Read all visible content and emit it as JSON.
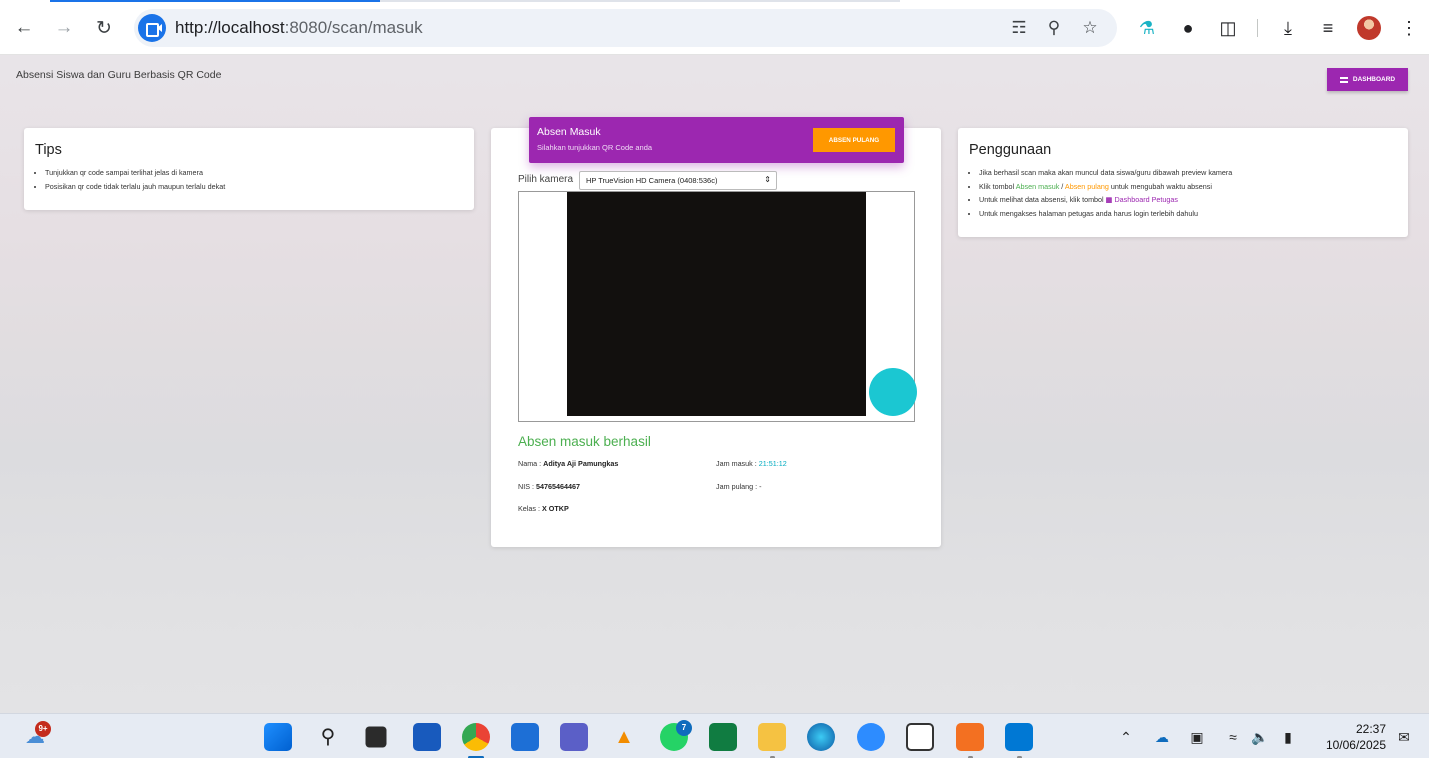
{
  "browser": {
    "url_host": "http://localhost",
    "url_path": ":8080/scan/masuk"
  },
  "page": {
    "app_title": "Absensi Siswa dan Guru Berbasis QR Code",
    "dashboard_button": "DASHBOARD"
  },
  "tips": {
    "title": "Tips",
    "items": [
      "Tunjukkan qr code sampai terlihat jelas di kamera",
      "Posisikan qr code tidak terlalu jauh maupun terlalu dekat"
    ]
  },
  "usage": {
    "title": "Penggunaan",
    "item1": "Jika berhasil scan maka akan muncul data siswa/guru dibawah preview kamera",
    "item2_pre": "Klik tombol ",
    "item2_masuk": "Absen masuk",
    "item2_sep": " / ",
    "item2_pulang": "Absen pulang",
    "item2_post": " untuk mengubah waktu absensi",
    "item3_pre": "Untuk melihat data absensi, klik tombol ",
    "item3_link": "Dashboard Petugas",
    "item4": "Untuk mengakses halaman petugas anda harus login terlebih dahulu"
  },
  "scan": {
    "header_title": "Absen Masuk",
    "header_subtitle": "Silahkan tunjukkan QR Code anda",
    "pulang_button": "ABSEN PULANG",
    "camera_label": "Pilih kamera",
    "camera_selected": "HP TrueVision HD Camera (0408:536c)",
    "result_title": "Absen masuk berhasil",
    "nama_label": "Nama : ",
    "nama_value": "Aditya Aji Pamungkas",
    "nis_label": "NIS : ",
    "nis_value": "54765464467",
    "kelas_label": "Kelas : ",
    "kelas_value": "X OTKP",
    "jam_masuk_label": "Jam masuk : ",
    "jam_masuk_value": "21:51:12",
    "jam_pulang_label": "Jam pulang : ",
    "jam_pulang_value": "-"
  },
  "taskbar": {
    "weather_badge": "9+",
    "whatsapp_badge": "7",
    "time": "22:37",
    "date": "10/06/2025"
  },
  "colors": {
    "primary": "#9c27b0",
    "accent": "#ff9800",
    "success": "#4caf50",
    "info": "#00acc1"
  }
}
